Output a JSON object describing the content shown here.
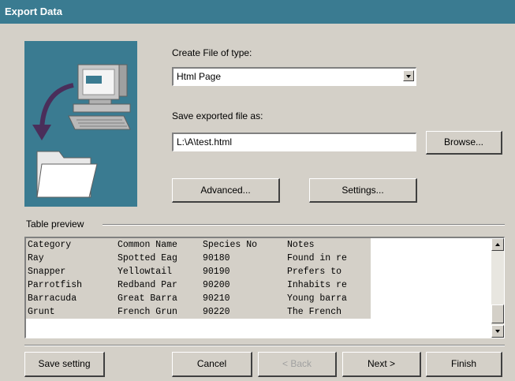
{
  "window": {
    "title": "Export Data"
  },
  "create": {
    "label": "Create File of type:",
    "selected": "Html Page"
  },
  "save": {
    "label": "Save exported file as:",
    "value": "L:\\A\\test.html",
    "browse_label": "Browse..."
  },
  "buttons": {
    "advanced": "Advanced...",
    "settings": "Settings...",
    "save_setting": "Save setting",
    "cancel": "Cancel",
    "back": "< Back",
    "next": "Next >",
    "finish": "Finish"
  },
  "preview": {
    "label": "Table preview",
    "columns": [
      "Category",
      "Common Name",
      "Species No",
      "Notes"
    ],
    "rows": [
      [
        "Ray",
        "Spotted Eag",
        "90180",
        "Found in re"
      ],
      [
        "Snapper",
        "Yellowtail",
        "90190",
        "Prefers to"
      ],
      [
        "Parrotfish",
        "Redband Par",
        "90200",
        "Inhabits re"
      ],
      [
        "Barracuda",
        "Great Barra",
        "90210",
        "Young barra"
      ],
      [
        "Grunt",
        "French Grun",
        "90220",
        "The French"
      ]
    ]
  },
  "colors": {
    "titlebar": "#3a7b91",
    "panel": "#d4d0c8",
    "illustration": "#3a7b91"
  },
  "icons": {
    "illustration": "computer-export-icon"
  }
}
